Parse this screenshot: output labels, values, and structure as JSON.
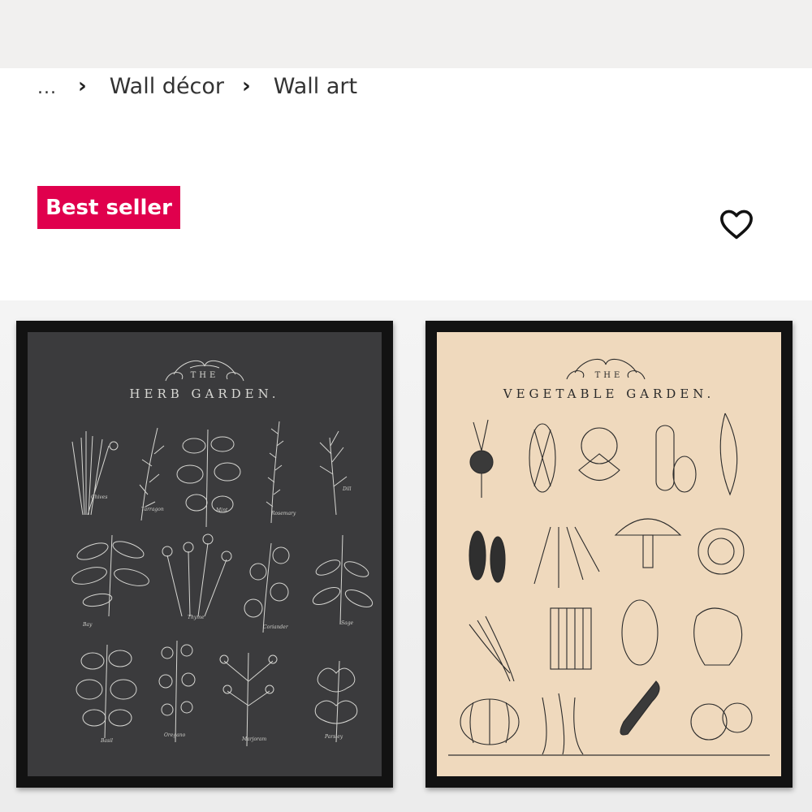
{
  "breadcrumb": {
    "ellipsis": "...",
    "separator": "›",
    "items": [
      "Wall décor",
      "Wall art"
    ]
  },
  "badge": {
    "label": "Best seller",
    "color": "#e0004d"
  },
  "wishlist": {
    "icon": "heart-outline-icon"
  },
  "posters": {
    "herb": {
      "the": "THE",
      "title": "HERB GARDEN.",
      "plants": [
        "Chives",
        "Tarragon",
        "Mint",
        "Rosemary",
        "Dill",
        "Bay",
        "Thyme",
        "Coriander",
        "Sage",
        "Basil",
        "Oregano",
        "Marjoram",
        "Parsley"
      ]
    },
    "vegetable": {
      "the": "THE",
      "title": "VEGETABLE GARDEN."
    }
  },
  "colors": {
    "top_bar": "#f1f0ef",
    "herb_background": "#3b3b3d",
    "vegetable_background": "#efd9bd",
    "frame": "#121212"
  }
}
